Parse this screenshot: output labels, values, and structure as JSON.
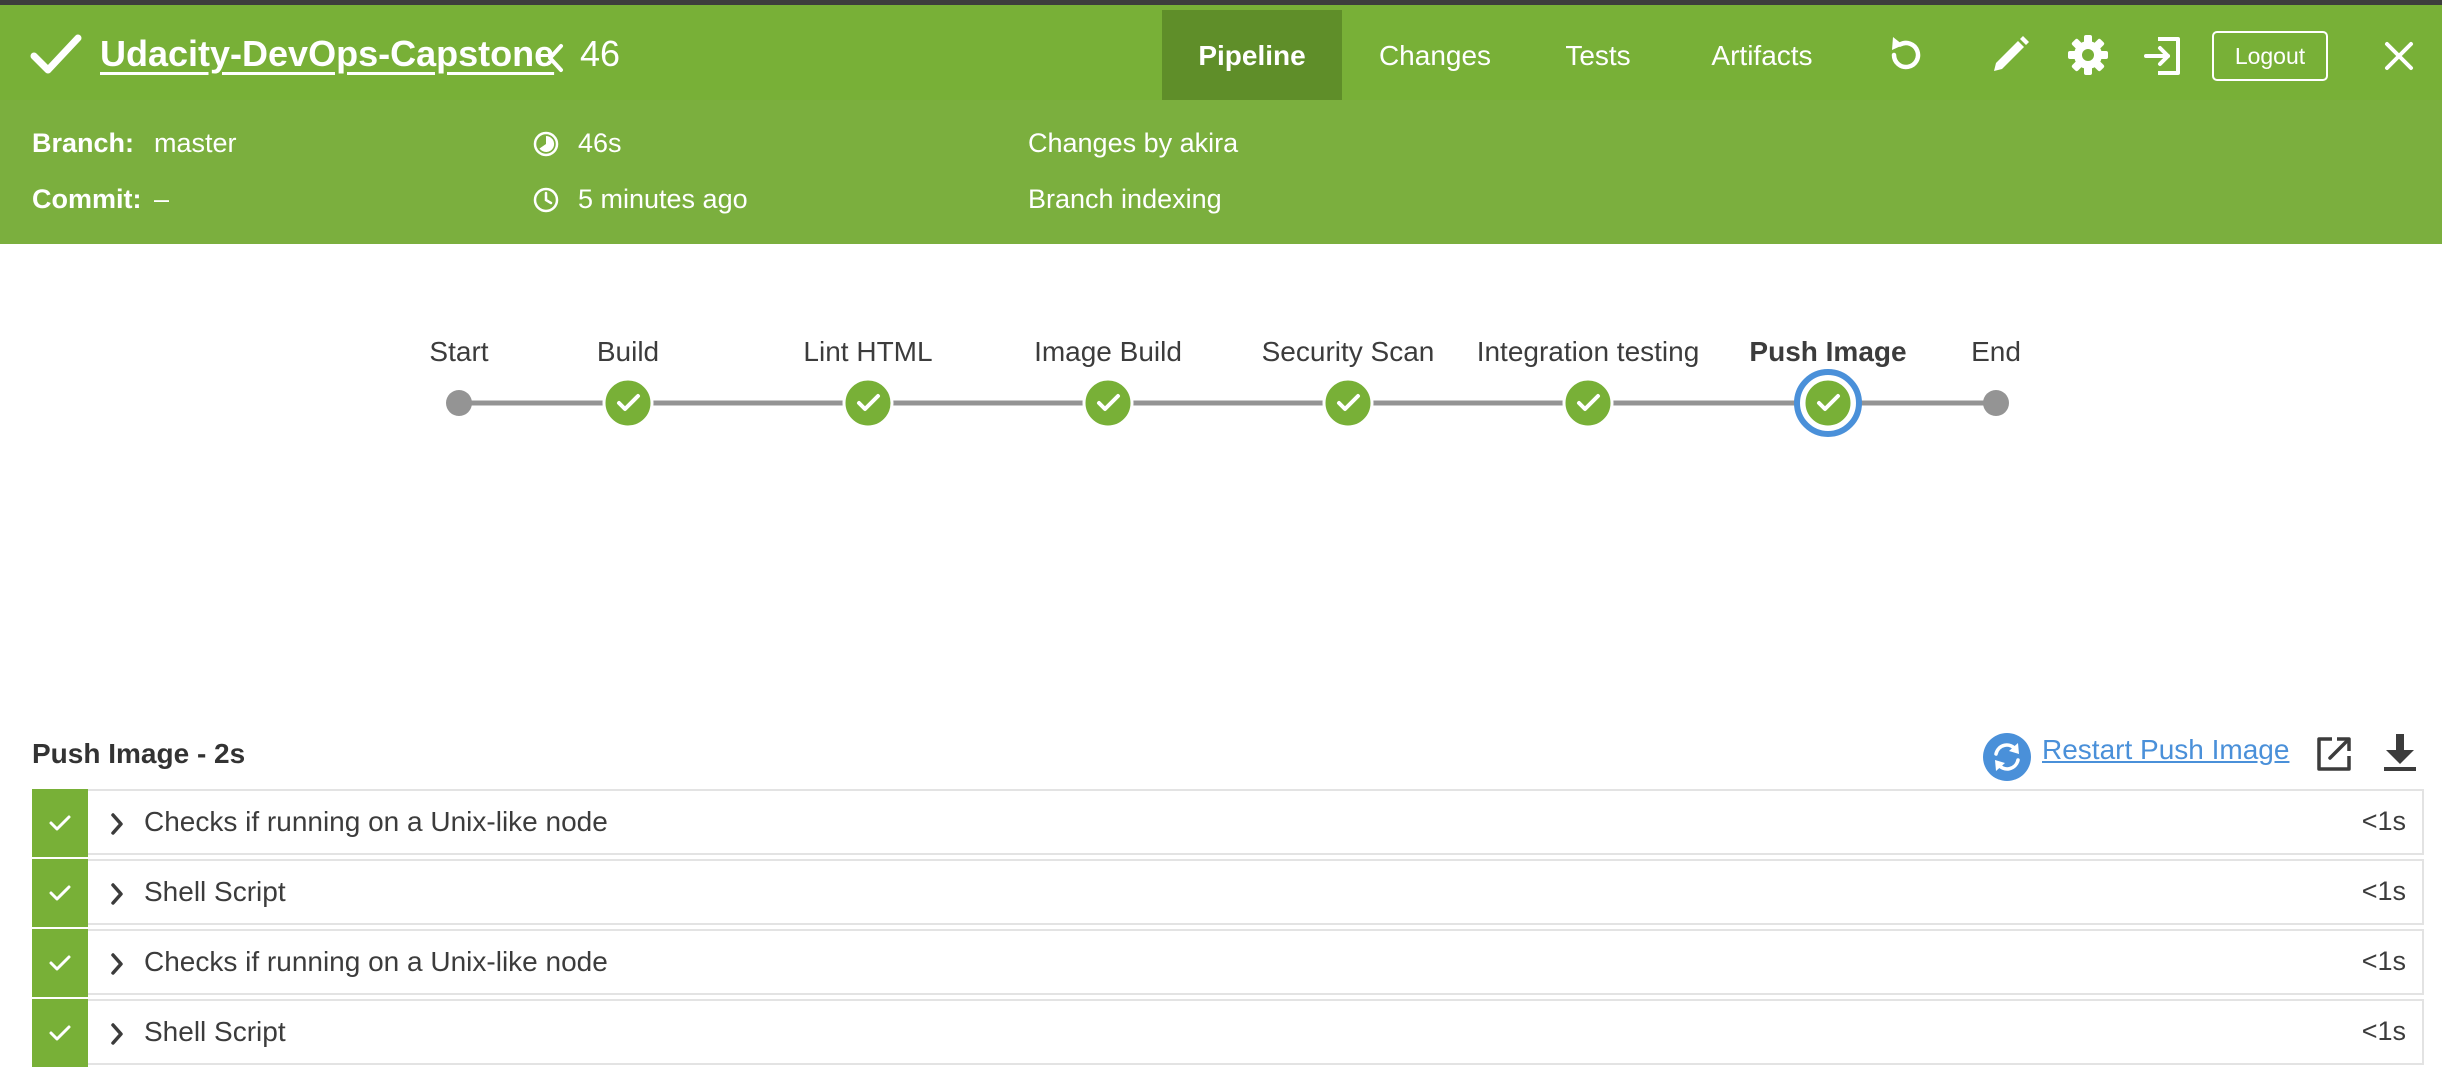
{
  "header": {
    "title": "Udacity-DevOps-Capstone",
    "run_number": "46",
    "tabs": [
      {
        "label": "Pipeline"
      },
      {
        "label": "Changes"
      },
      {
        "label": "Tests"
      },
      {
        "label": "Artifacts"
      }
    ],
    "logout_label": "Logout"
  },
  "info": {
    "branch_label": "Branch:",
    "branch_value": "master",
    "commit_label": "Commit:",
    "commit_value": "–",
    "duration": "46s",
    "time_ago": "5 minutes ago",
    "changes_by": "Changes by akira",
    "cause": "Branch indexing"
  },
  "pipeline": {
    "stages": [
      {
        "name": "Start",
        "status": "terminal"
      },
      {
        "name": "Build",
        "status": "success"
      },
      {
        "name": "Lint HTML",
        "status": "success"
      },
      {
        "name": "Image Build",
        "status": "success"
      },
      {
        "name": "Security Scan",
        "status": "success"
      },
      {
        "name": "Integration testing",
        "status": "success"
      },
      {
        "name": "Push Image",
        "status": "success",
        "selected": true
      },
      {
        "name": "End",
        "status": "terminal"
      }
    ]
  },
  "details": {
    "title": "Push Image - 2s",
    "restart_label": "Restart Push Image",
    "steps": [
      {
        "label": "Checks if running on a Unix-like node",
        "duration": "<1s"
      },
      {
        "label": "Shell Script",
        "duration": "<1s"
      },
      {
        "label": "Checks if running on a Unix-like node",
        "duration": "<1s"
      },
      {
        "label": "Shell Script",
        "duration": "<1s"
      }
    ]
  },
  "colors": {
    "success": "#78b037",
    "header_bg": "#78b037",
    "tab_active_bg": "#5f8e29",
    "selected_ring": "#4a90d9",
    "link": "#4a90d9",
    "terminal_node": "#949494"
  }
}
